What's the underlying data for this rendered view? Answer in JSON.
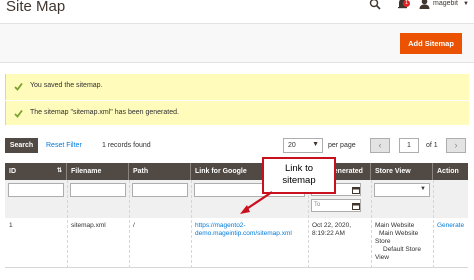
{
  "header": {
    "title": "Site Map",
    "notification_count": "1",
    "username": "magebit"
  },
  "actions": {
    "add_sitemap": "Add Sitemap"
  },
  "messages": [
    "You saved the sitemap.",
    "The sitemap \"sitemap.xml\" has been generated."
  ],
  "toolbar": {
    "search": "Search",
    "reset_filter": "Reset Filter",
    "records_found": "1 records found",
    "per_page_value": "20",
    "per_page_label": "per page",
    "page_value": "1",
    "page_of": "of 1"
  },
  "grid": {
    "columns": [
      "ID",
      "Filename",
      "Path",
      "Link for Google",
      "Last Generated",
      "Store View",
      "Action"
    ],
    "date_to_placeholder": "To",
    "rows": [
      {
        "id": "1",
        "filename": "sitemap.xml",
        "path": "/",
        "link_line1": "https://magento2-",
        "link_line2": "demo.mageintip.com/sitemap.xml",
        "generated_line1": "Oct 22, 2020,",
        "generated_line2": "8:19:22 AM",
        "store_line1": "Main Website",
        "store_line2": "Main Website",
        "store_line3": "Store",
        "store_line4": "Default Store",
        "store_line5": "View",
        "action": "Generate"
      }
    ]
  },
  "annotation": {
    "line1": "Link to",
    "line2": "sitemap"
  },
  "colors": {
    "accent": "#eb5202",
    "header_bg": "#514943",
    "link": "#007bdb",
    "message_bg": "#fffbbb",
    "callout_border": "#c8101e"
  }
}
